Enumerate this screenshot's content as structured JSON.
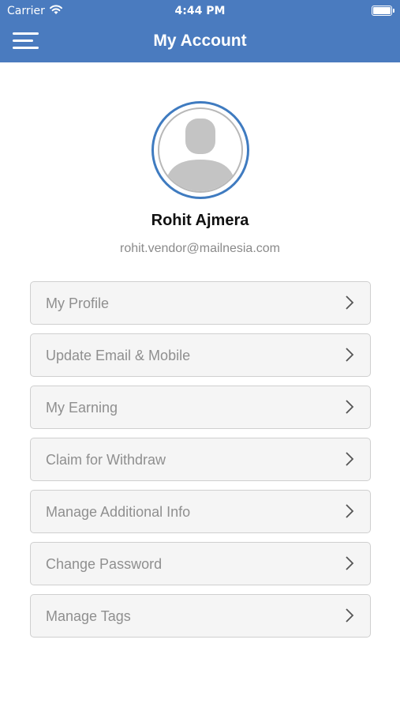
{
  "status_bar": {
    "carrier": "Carrier",
    "time": "4:44 PM"
  },
  "header": {
    "title": "My Account"
  },
  "profile": {
    "name": "Rohit Ajmera",
    "email": "rohit.vendor@mailnesia.com"
  },
  "menu_items": [
    {
      "label": "My Profile"
    },
    {
      "label": "Update Email & Mobile"
    },
    {
      "label": "My Earning"
    },
    {
      "label": "Claim for Withdraw"
    },
    {
      "label": "Manage Additional Info"
    },
    {
      "label": "Change Password"
    },
    {
      "label": "Manage Tags"
    }
  ],
  "colors": {
    "header_bg": "#4a7bbf",
    "avatar_ring": "#3f7bc0"
  },
  "icons": [
    "hamburger-menu-icon",
    "wifi-icon",
    "battery-icon",
    "user-avatar-icon",
    "chevron-right-icon"
  ]
}
